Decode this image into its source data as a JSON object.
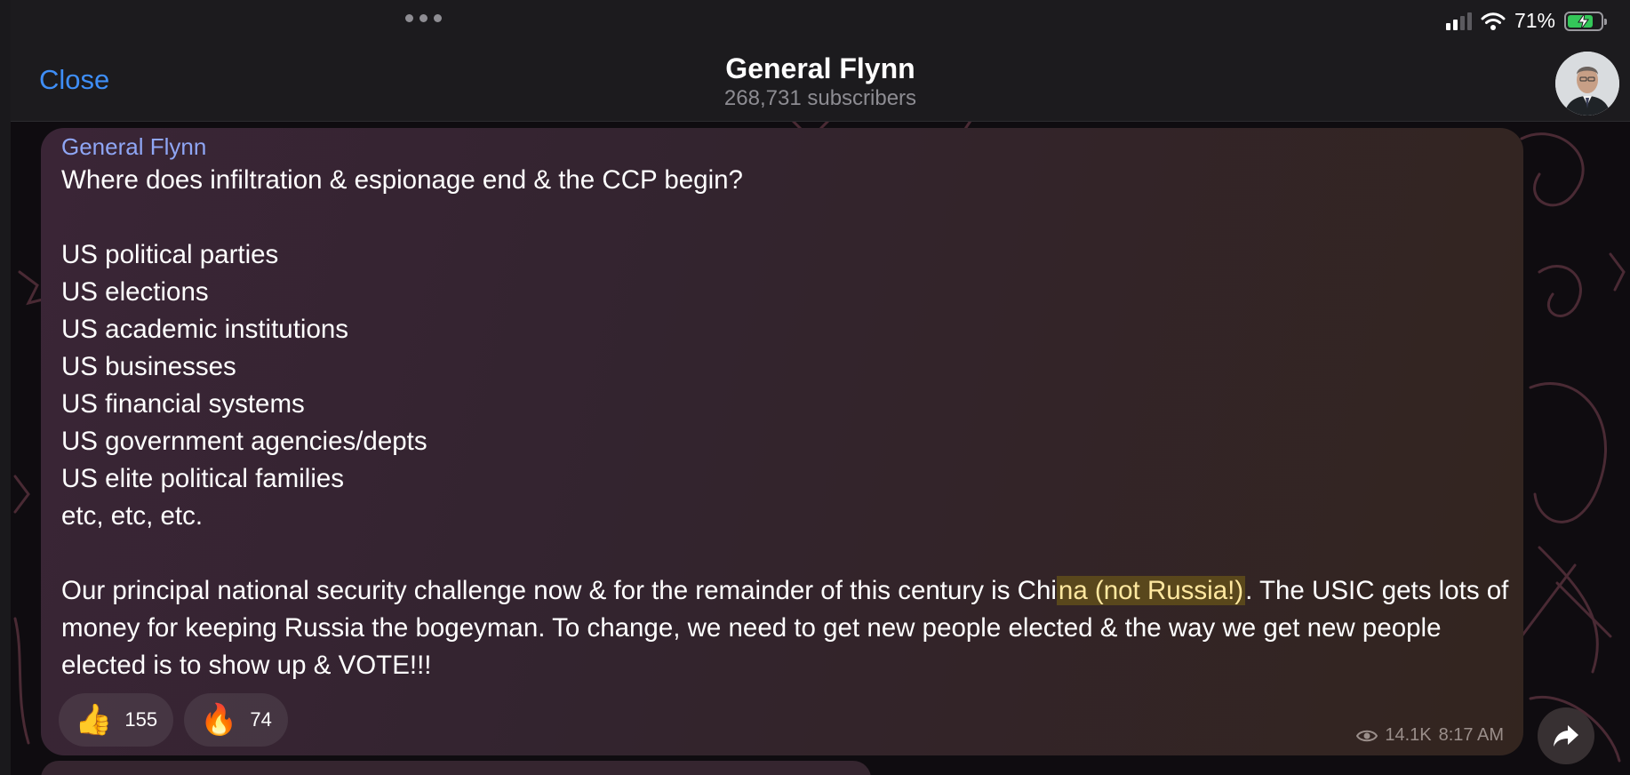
{
  "status_bar": {
    "battery_percent": "71%",
    "signal_bars": 2
  },
  "header": {
    "close_label": "Close",
    "title": "General Flynn",
    "subscribers": "268,731 subscribers"
  },
  "message": {
    "sender": "General Flynn",
    "lines": [
      "Where does infiltration & espionage end & the CCP begin?",
      "",
      "US political parties",
      "US elections",
      "US academic institutions",
      "US businesses",
      "US financial systems",
      "US government agencies/depts",
      "US elite political families",
      "etc, etc, etc.",
      ""
    ],
    "paragraph_before": "Our principal national security challenge now & for the remainder of this century is Chi",
    "paragraph_highlight": "na (not Russia!)",
    "paragraph_after": ". The USIC gets lots of money for keeping Russia the bogeyman. To change, we need to get new people elected & the way we get new people elected is to show up & VOTE!!!",
    "reactions": [
      {
        "emoji": "👍",
        "count": "155"
      },
      {
        "emoji": "🔥",
        "count": "74"
      }
    ],
    "views": "14.1K",
    "time": "8:17 AM"
  },
  "colors": {
    "accent": "#3e8ef7",
    "sender": "#8fa6f5",
    "highlight": "#ffe8a0"
  }
}
